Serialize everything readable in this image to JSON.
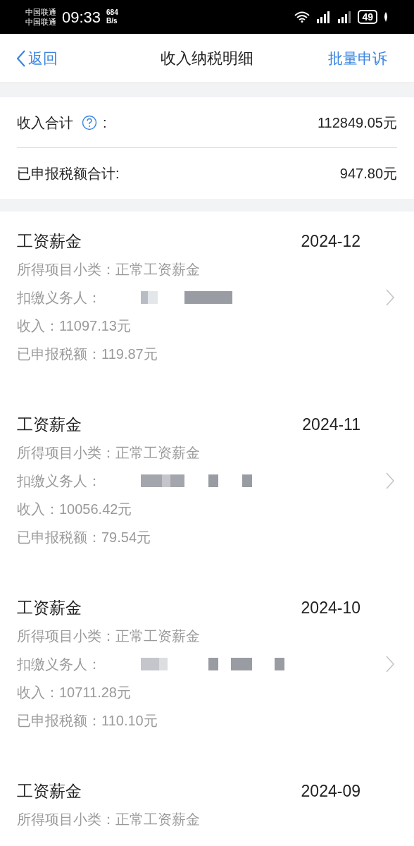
{
  "status_bar": {
    "carriers": [
      "中国联通",
      "中国联通"
    ],
    "time": "09:33",
    "speed": [
      "684",
      "B/s"
    ],
    "battery": "49"
  },
  "nav": {
    "back": "返回",
    "title": "收入纳税明细",
    "action": "批量申诉"
  },
  "summary": [
    {
      "label": "收入合计",
      "help": true,
      "colon": ":",
      "value": "112849.05元"
    },
    {
      "label": "已申报税额合计:",
      "help": false,
      "value": "947.80元"
    }
  ],
  "records": [
    {
      "title": "工资薪金",
      "period": "2024-12",
      "subtype": "所得项目小类：正常工资薪金",
      "payer_label": "扣缴义务人：",
      "income": "收入：11097.13元",
      "tax": "已申报税额：119.87元"
    },
    {
      "title": "工资薪金",
      "period": "2024-11",
      "subtype": "所得项目小类：正常工资薪金",
      "payer_label": "扣缴义务人：",
      "income": "收入：10056.42元",
      "tax": "已申报税额：79.54元"
    },
    {
      "title": "工资薪金",
      "period": "2024-10",
      "subtype": "所得项目小类：正常工资薪金",
      "payer_label": "扣缴义务人：",
      "income": "收入：10711.28元",
      "tax": "已申报税额：110.10元"
    },
    {
      "title": "工资薪金",
      "period": "2024-09",
      "subtype": "所得项目小类：正常工资薪金"
    }
  ]
}
